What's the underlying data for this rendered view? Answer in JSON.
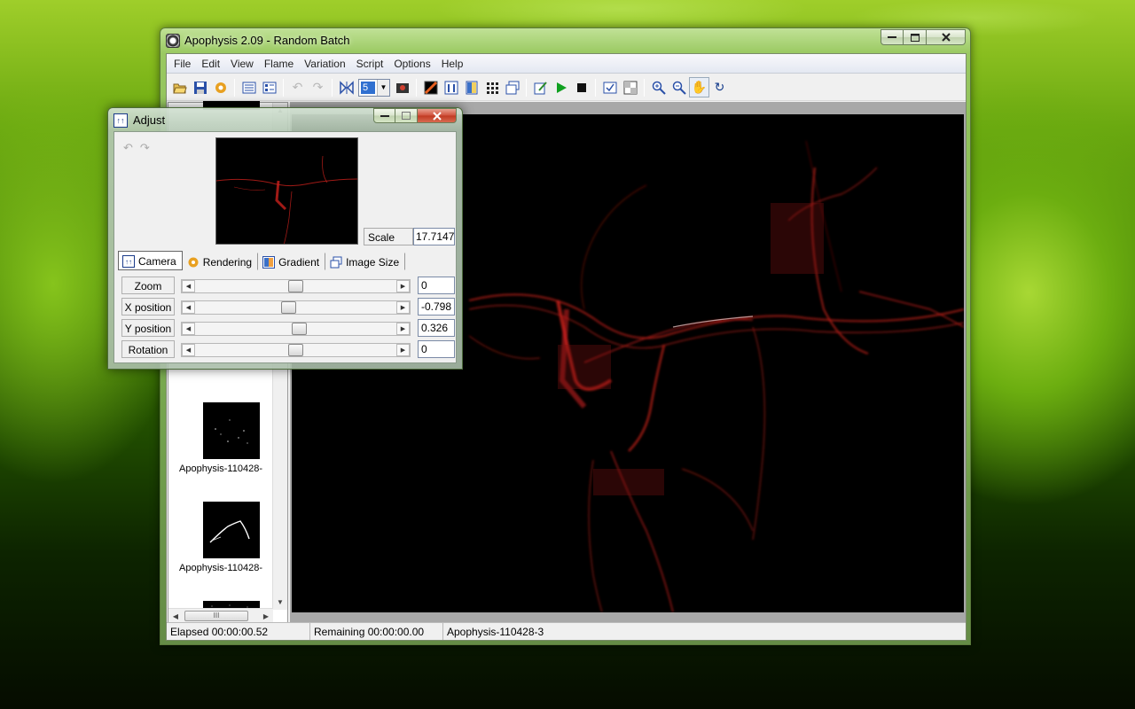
{
  "main_window": {
    "title": "Apophysis 2.09 - Random Batch",
    "controls": {
      "minimize": "▭",
      "maximize": "□",
      "close": "✕"
    }
  },
  "menu": {
    "items": [
      "File",
      "Edit",
      "View",
      "Flame",
      "Variation",
      "Script",
      "Options",
      "Help"
    ]
  },
  "toolbar": {
    "quality_value": "5",
    "icons": [
      "open-icon",
      "save-icon",
      "render-icon",
      "list-view-icon",
      "icon-view-icon",
      "undo-icon",
      "redo-icon",
      "mutate-icon",
      "quality-combo",
      "fullscreen-icon",
      "gradient-icon",
      "adjust-icon",
      "palette-icon",
      "grid-icon",
      "image-size-icon",
      "script-edit-icon",
      "play-icon",
      "stop-icon",
      "options-icon",
      "transparency-icon",
      "zoom-in-icon",
      "zoom-out-icon",
      "pan-hand-icon",
      "rotate-icon"
    ]
  },
  "thumbnails": {
    "items": [
      {
        "label": "Apophysis-110428-"
      },
      {
        "label": "Apophysis-110428-"
      }
    ]
  },
  "status": {
    "elapsed": "Elapsed 00:00:00.52",
    "remaining": "Remaining 00:00:00.00",
    "flame": "Apophysis-110428-3"
  },
  "adjust": {
    "title": "Adjust",
    "scale_label": "Scale",
    "scale_value": "17.7147",
    "tabs": [
      "Camera",
      "Rendering",
      "Gradient",
      "Image Size"
    ],
    "params": [
      {
        "label": "Zoom",
        "value": "0",
        "position": 0.5
      },
      {
        "label": "X position",
        "value": "-0.798",
        "position": 0.46
      },
      {
        "label": "Y position",
        "value": "0.326",
        "position": 0.52
      },
      {
        "label": "Rotation",
        "value": "0",
        "position": 0.5
      }
    ]
  },
  "colors": {
    "flame_red": "#c8201c",
    "desktop_green": "#6aa810"
  }
}
